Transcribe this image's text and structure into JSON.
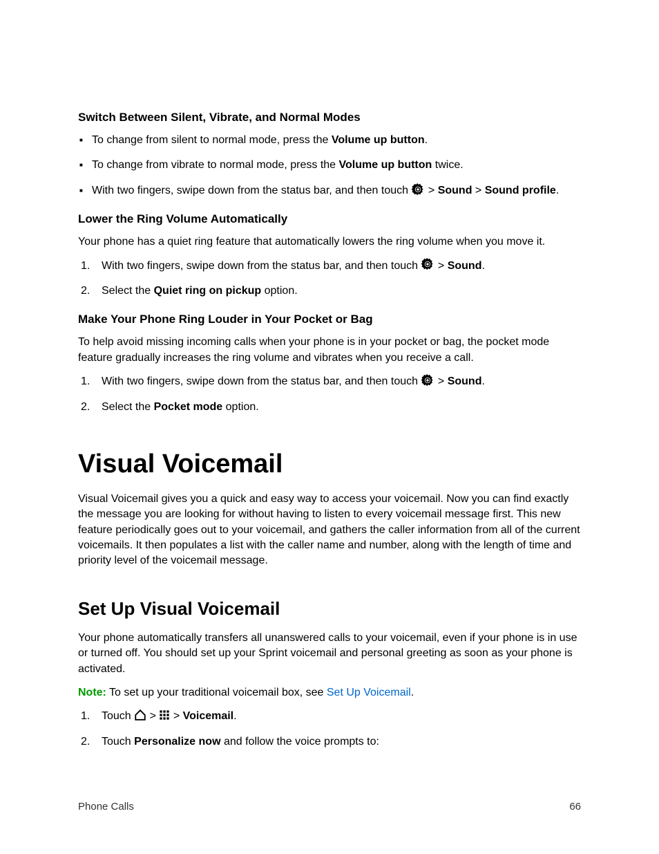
{
  "sec1": {
    "heading": "Switch Between Silent, Vibrate, and Normal Modes",
    "b1_pre": "To change from silent to normal mode, press the ",
    "b1_bold": "Volume up button",
    "b1_post": ".",
    "b2_pre": "To change from vibrate to normal mode, press the ",
    "b2_bold": "Volume up button",
    "b2_post": " twice.",
    "b3_pre": "With two fingers, swipe down from the status bar, and then touch ",
    "b3_gt1": " > ",
    "b3_bold1": "Sound",
    "b3_gt2": " > ",
    "b3_bold2": "Sound profile",
    "b3_post": "."
  },
  "sec2": {
    "heading": "Lower the Ring Volume Automatically",
    "para": "Your phone has a quiet ring feature that automatically lowers the ring volume when you move it.",
    "s1_pre": "With two fingers, swipe down from the status bar, and then touch ",
    "s1_gt": " > ",
    "s1_bold": "Sound",
    "s1_post": ".",
    "s2_pre": "Select the ",
    "s2_bold": "Quiet ring on pickup",
    "s2_post": " option."
  },
  "sec3": {
    "heading": "Make Your Phone Ring Louder in Your Pocket or Bag",
    "para": "To help avoid missing incoming calls when your phone is in your pocket or bag, the pocket mode feature gradually increases the ring volume and vibrates when you receive a call.",
    "s1_pre": "With two fingers, swipe down from the status bar, and then touch ",
    "s1_gt": " > ",
    "s1_bold": "Sound",
    "s1_post": ".",
    "s2_pre": "Select the ",
    "s2_bold": "Pocket mode",
    "s2_post": " option."
  },
  "vv": {
    "title": "Visual Voicemail",
    "para": "Visual Voicemail gives you a quick and easy way to access your voicemail. Now you can find exactly the message you are looking for without having to listen to every voicemail message first. This new feature periodically goes out to your voicemail, and gathers the caller information from all of the current voicemails. It then populates a list with the caller name and number, along with the length of time and priority level of the voicemail message.",
    "setup_title": "Set Up Visual Voicemail",
    "setup_para": "Your phone automatically transfers all unanswered calls to your voicemail, even if your phone is in use or turned off. You should set up your Sprint voicemail and personal greeting as soon as your phone is activated.",
    "note_label": "Note:",
    "note_text": " To set up your traditional voicemail box, see ",
    "note_link": "Set Up Voicemail",
    "note_post": ".",
    "s1_pre": "Touch ",
    "s1_gt1": " > ",
    "s1_gt2": " > ",
    "s1_bold": "Voicemail",
    "s1_post": ".",
    "s2_pre": "Touch ",
    "s2_bold": "Personalize now",
    "s2_post": " and follow the voice prompts to:"
  },
  "footer": {
    "section": "Phone Calls",
    "page": "66"
  }
}
